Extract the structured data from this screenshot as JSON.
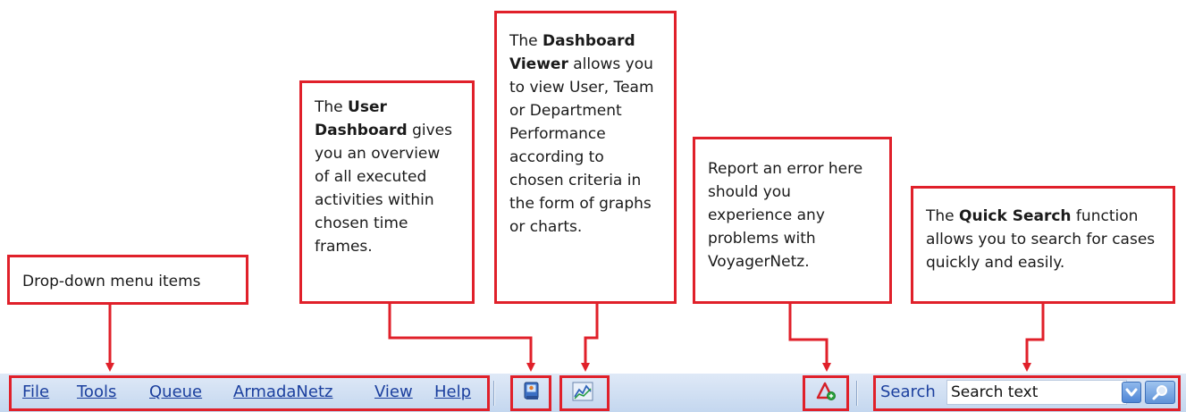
{
  "callouts": {
    "dropdown": {
      "text": "Drop-down menu items"
    },
    "user_dashboard": {
      "pre": "The ",
      "bold": "User Dashboard",
      "post": " gives you an overview of all executed activities within chosen time frames."
    },
    "dashboard_viewer": {
      "pre": "The ",
      "bold": "Dashboard Viewer",
      "post": " allows you to view User, Team or Department Performance according to chosen criteria in the form of graphs or charts."
    },
    "report_error": {
      "text": "Report an error here should you experience any problems with VoyagerNetz."
    },
    "quick_search": {
      "pre": "The ",
      "bold": "Quick Search",
      "post": " function allows you to search for cases quickly and easily."
    }
  },
  "menu": {
    "items": [
      {
        "label": "File"
      },
      {
        "label": "Tools"
      },
      {
        "label": "Queue"
      },
      {
        "label": "ArmadaNetz"
      },
      {
        "label": "View"
      },
      {
        "label": "Help"
      }
    ]
  },
  "search": {
    "label": "Search",
    "value": "Search text"
  },
  "icons": {
    "user_dashboard": "user-dashboard-icon",
    "dashboard_viewer": "chart-icon",
    "report_error": "error-report-icon",
    "dropdown": "chevron-down-icon",
    "search_go": "magnifier-icon"
  },
  "colors": {
    "highlight": "#e0202a",
    "toolbar_top": "#dfe9f7",
    "toolbar_bottom": "#c4d7ef",
    "menu_text": "#1b3f9e"
  }
}
